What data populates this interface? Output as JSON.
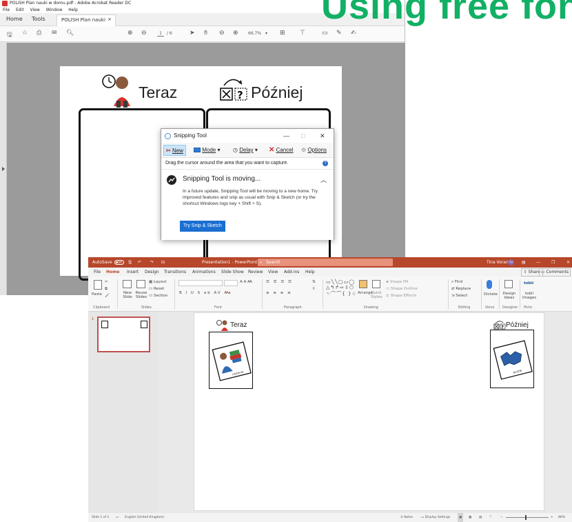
{
  "watermark": {
    "text": "Using free fonts"
  },
  "acrobat": {
    "title": "POLISH Plan nauki w domu.pdf - Adobe Acrobat Reader DC",
    "menu": [
      "File",
      "Edit",
      "View",
      "Window",
      "Help"
    ],
    "tabs": {
      "home": "Home",
      "tools": "Tools",
      "doc": "POLISH Plan nauki ...",
      "close": "×"
    },
    "toolbar": {
      "page_current": "1",
      "page_total": "/ 6",
      "zoom": "66.7%"
    },
    "page": {
      "now_label": "Teraz",
      "later_label": "Później"
    }
  },
  "snip": {
    "title": "Snipping Tool",
    "min": "—",
    "max": "□",
    "close": "✕",
    "tools": {
      "new": "New",
      "mode": "Mode",
      "delay": "Delay",
      "cancel": "Cancel",
      "options": "Options"
    },
    "hint": "Drag the cursor around the area that you want to capture.",
    "help": "?",
    "heading": "Snipping Tool is moving...",
    "message": "In a future update, Snipping Tool will be moving to a new home. Try improved features and snip as usual with Snip & Sketch (or try the shortcut Windows logo key + Shift + S).",
    "try_button": "Try Snip & Sketch"
  },
  "ppt": {
    "autosave": "AutoSave",
    "autosave_state": "Off",
    "doc_title": "Presentation1 - PowerPoint",
    "search": "Search",
    "user": "Tina Vorany",
    "user_initials": "TV",
    "menu": [
      "File",
      "Home",
      "Insert",
      "Design",
      "Transitions",
      "Animations",
      "Slide Show",
      "Review",
      "View",
      "Add-ins",
      "Help"
    ],
    "share": "Share",
    "comments": "Comments",
    "ribbon": {
      "paste": "Paste",
      "clipboard": "Clipboard",
      "new_slide": "New Slide",
      "reuse_slides": "Reuse Slides",
      "layout": "Layout",
      "reset": "Reset",
      "section": "Section",
      "slides": "Slides",
      "font": "Font",
      "paragraph": "Paragraph",
      "arrange": "Arrange",
      "quick_styles": "Quick Styles",
      "shape_fill": "Shape Fill",
      "shape_outline": "Shape Outline",
      "shape_effects": "Shape Effects",
      "drawing": "Drawing",
      "find": "Find",
      "replace": "Replace",
      "select": "Select",
      "editing": "Editing",
      "dictate": "Dictate",
      "voice": "Voice",
      "design_ideas": "Design Ideas",
      "designer": "Designer",
      "tobii": "tobii",
      "tobii_images": "tobii Images",
      "picto": "Picto"
    },
    "thumb_number": "1",
    "slide": {
      "now_label": "Teraz",
      "later_label": "Później",
      "card_left_caption": "czytanie",
      "card_right_caption": "puzzle"
    },
    "status": {
      "slide_count": "Slide 1 of 1",
      "language": "English (United Kingdom)",
      "notes": "Notes",
      "display": "Display Settings",
      "zoom": "86%"
    }
  }
}
